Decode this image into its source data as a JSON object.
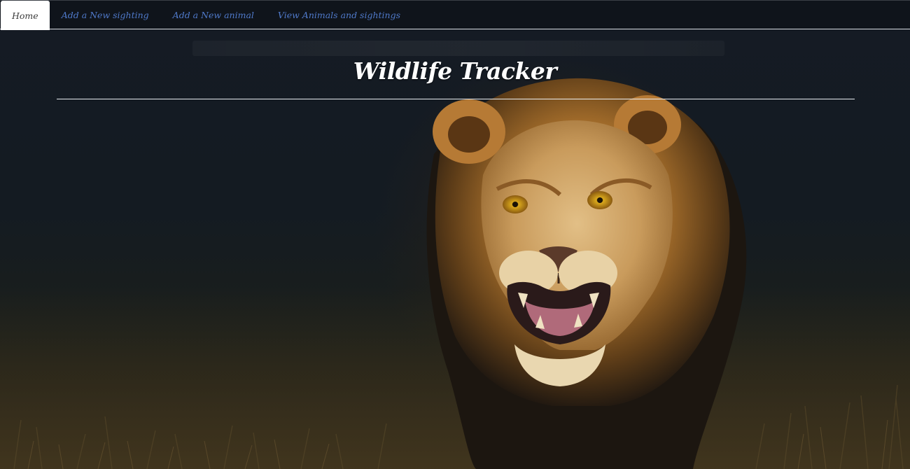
{
  "nav": {
    "items": [
      {
        "label": "Home",
        "active": true
      },
      {
        "label": "Add a New sighting",
        "active": false
      },
      {
        "label": "Add a New animal",
        "active": false
      },
      {
        "label": "View Animals and sightings",
        "active": false
      }
    ]
  },
  "header": {
    "title": "Wildlife Tracker"
  },
  "colors": {
    "nav_link": "#4f79c9",
    "active_tab_bg": "#ffffff",
    "title": "#ffffff"
  },
  "background": {
    "image_subject": "snarling-lion-photo"
  }
}
